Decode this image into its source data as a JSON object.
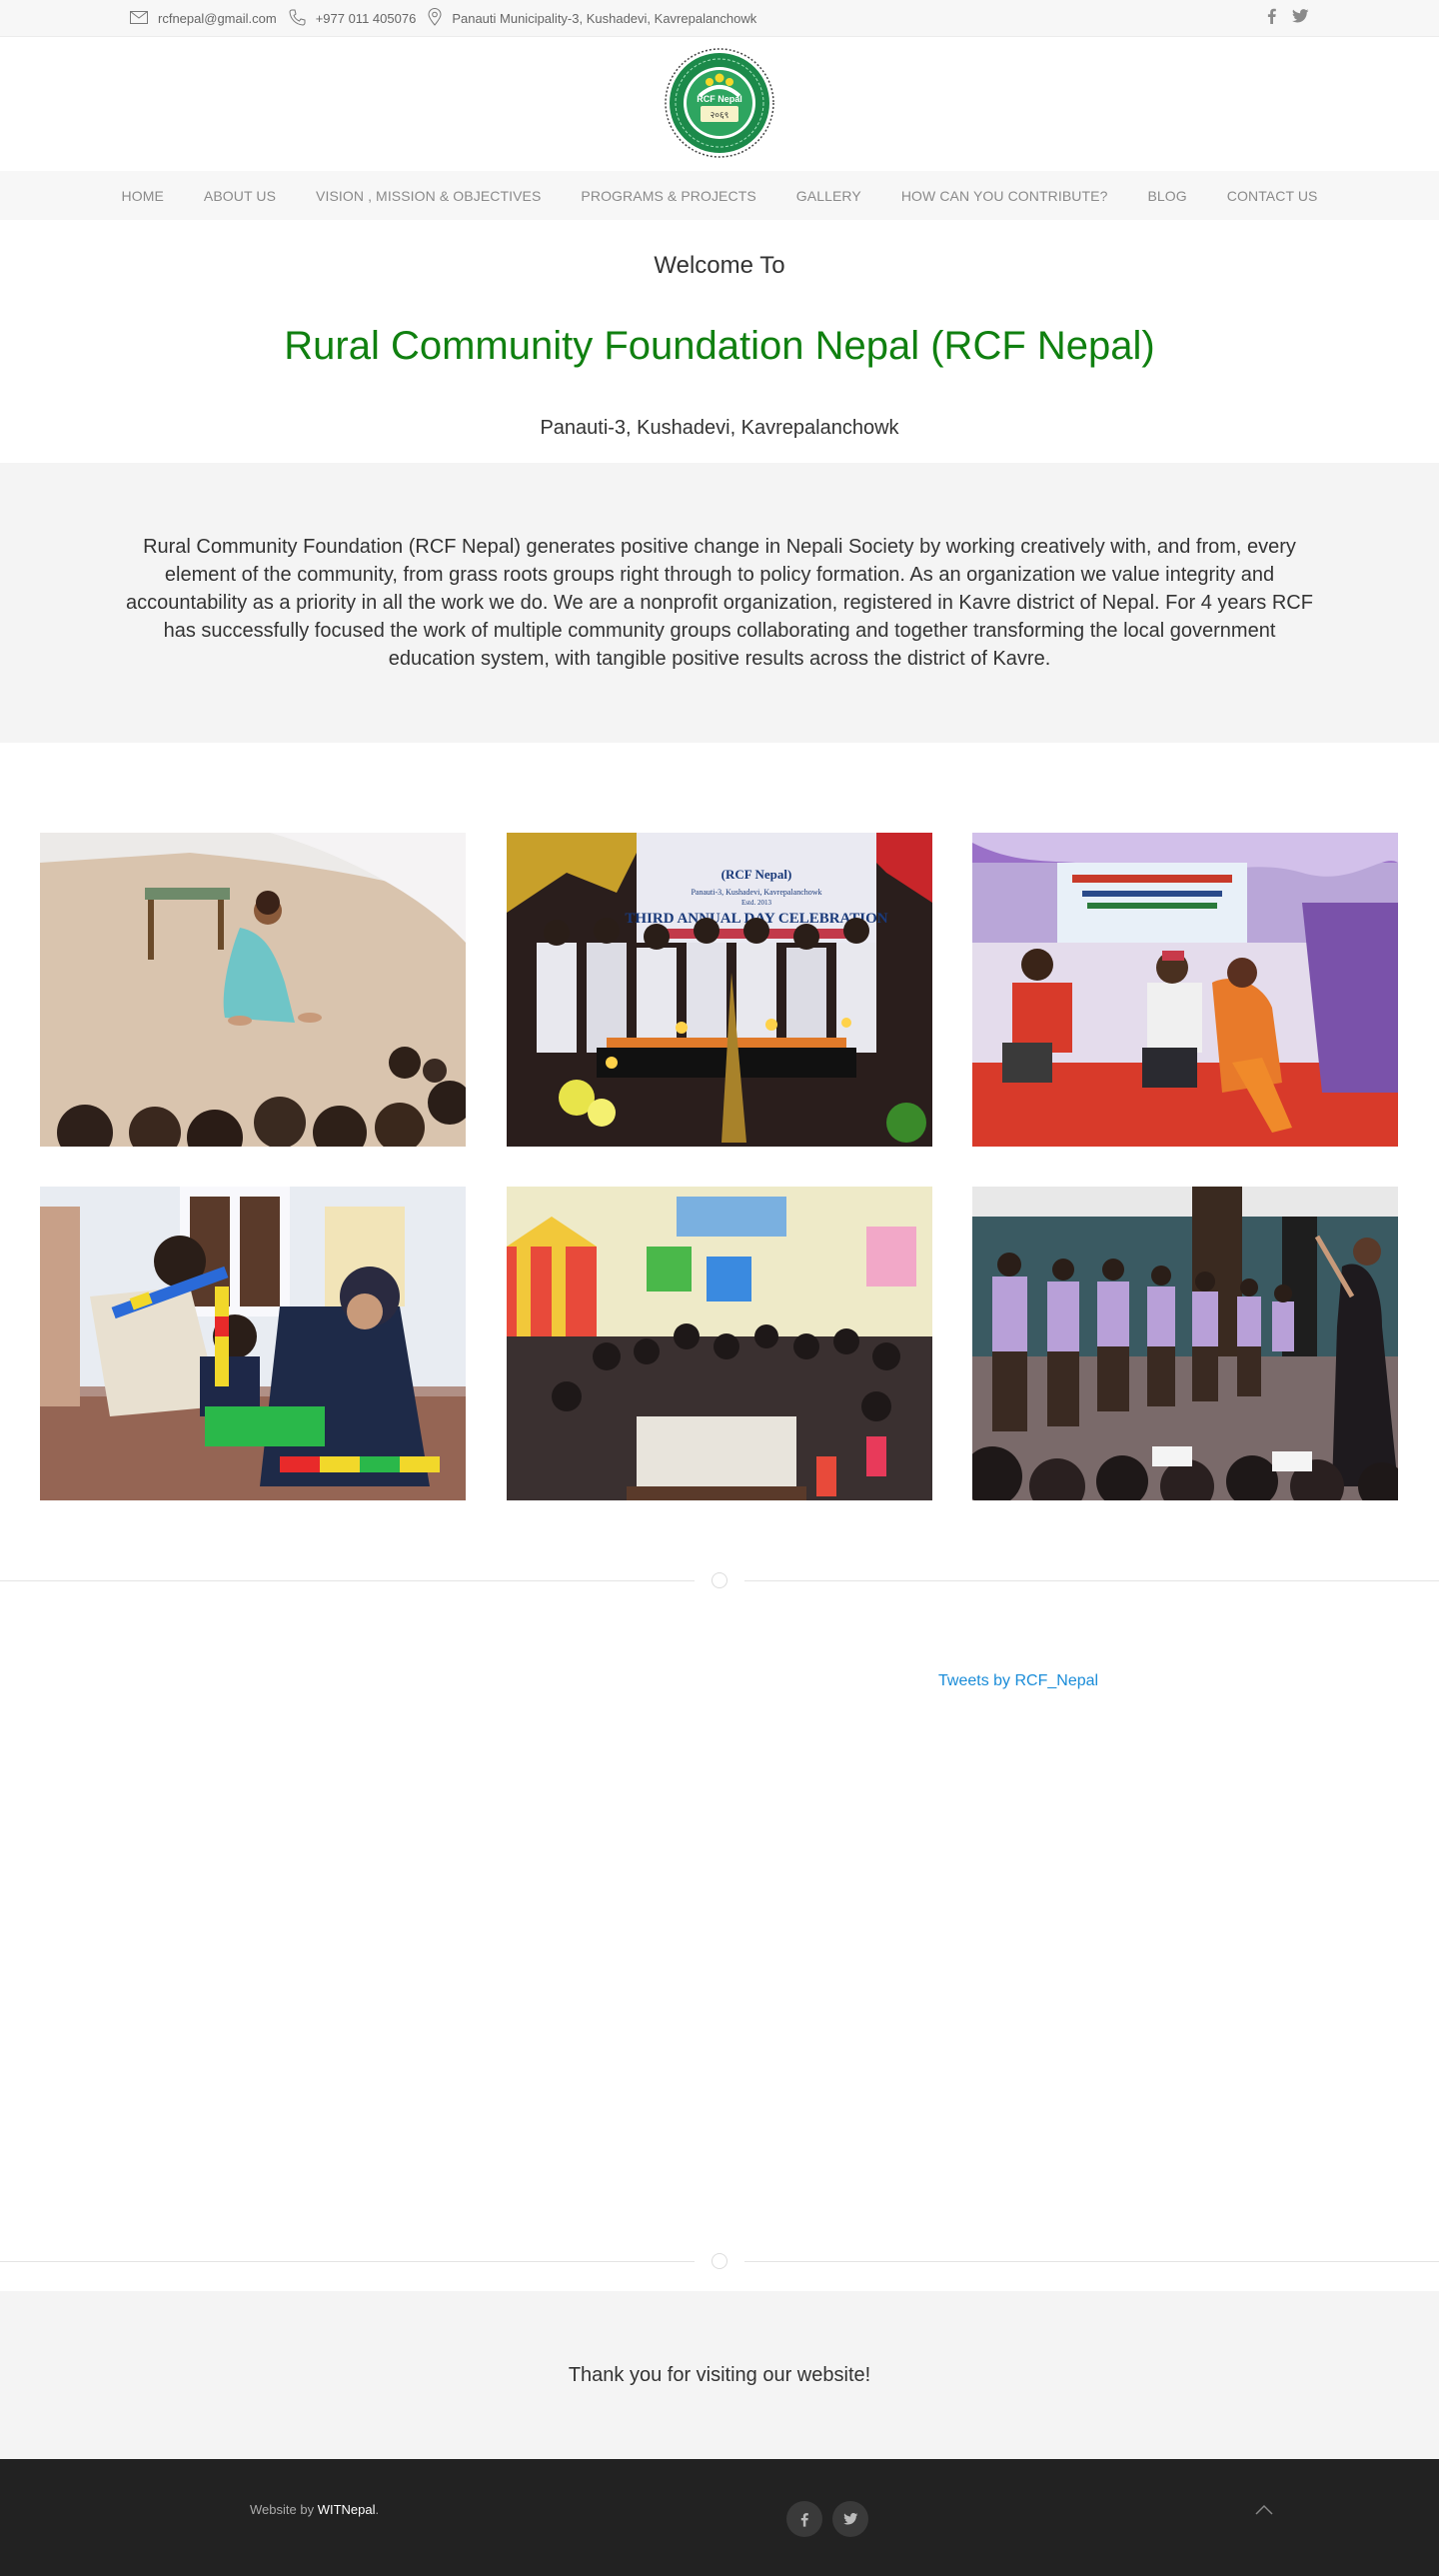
{
  "topbar": {
    "email": "rcfnepal@gmail.com",
    "phone": "+977 011 405076",
    "address": "Panauti Municipality-3, Kushadevi, Kavrepalanchowk",
    "icons": [
      "mail-icon",
      "phone-icon",
      "location-pin-icon",
      "facebook-icon",
      "twitter-icon"
    ]
  },
  "logo": {
    "text": "RCF Nepal",
    "year": "२०६९"
  },
  "nav": {
    "items": [
      {
        "label": "HOME"
      },
      {
        "label": "ABOUT US"
      },
      {
        "label": "VISION , MISSION & OBJECTIVES"
      },
      {
        "label": "PROGRAMS & PROJECTS"
      },
      {
        "label": "GALLERY"
      },
      {
        "label": "HOW CAN YOU CONTRIBUTE?"
      },
      {
        "label": "BLOG"
      },
      {
        "label": "CONTACT US"
      }
    ]
  },
  "welcome": {
    "line1": "Welcome To",
    "title": "Rural Community Foundation Nepal (RCF Nepal)",
    "location": "Panauti-3, Kushadevi, Kavrepalanchowk",
    "title_color": "#108010"
  },
  "intro": {
    "text": "Rural Community Foundation (RCF Nepal) generates positive change in Nepali Society by working creatively with, and from, every element of the community, from grass roots groups right through to policy formation. As an organization we value integrity and accountability as a priority in all the work we do. We are a nonprofit organization, registered in Kavre district of Nepal. For 4 years RCF has successfully focused the work of multiple community groups collaborating and together transforming the local government education system, with tangible positive results across the district of Kavre."
  },
  "gallery": {
    "photos": [
      {
        "name": "photo-girl-performing"
      },
      {
        "name": "photo-third-annual-day",
        "banner_lines": [
          "(RCF Nepal)",
          "Panauti-3, Kushadevi, Kavrepalanchowk",
          "Estd. 2013",
          "THIRD ANNUAL DAY CELEBRATION"
        ]
      },
      {
        "name": "photo-children-drama"
      },
      {
        "name": "photo-kids-building-blocks"
      },
      {
        "name": "photo-classroom-children"
      },
      {
        "name": "photo-violin-performance"
      }
    ]
  },
  "tweets": {
    "label": "Tweets by RCF_Nepal"
  },
  "thanks": {
    "text": "Thank you for visiting our website!"
  },
  "footer": {
    "credit_prefix": "Website by ",
    "credit_link": "WITNepal",
    "credit_suffix": ".",
    "icons": [
      "facebook-icon",
      "twitter-icon",
      "back-to-top-icon"
    ]
  }
}
